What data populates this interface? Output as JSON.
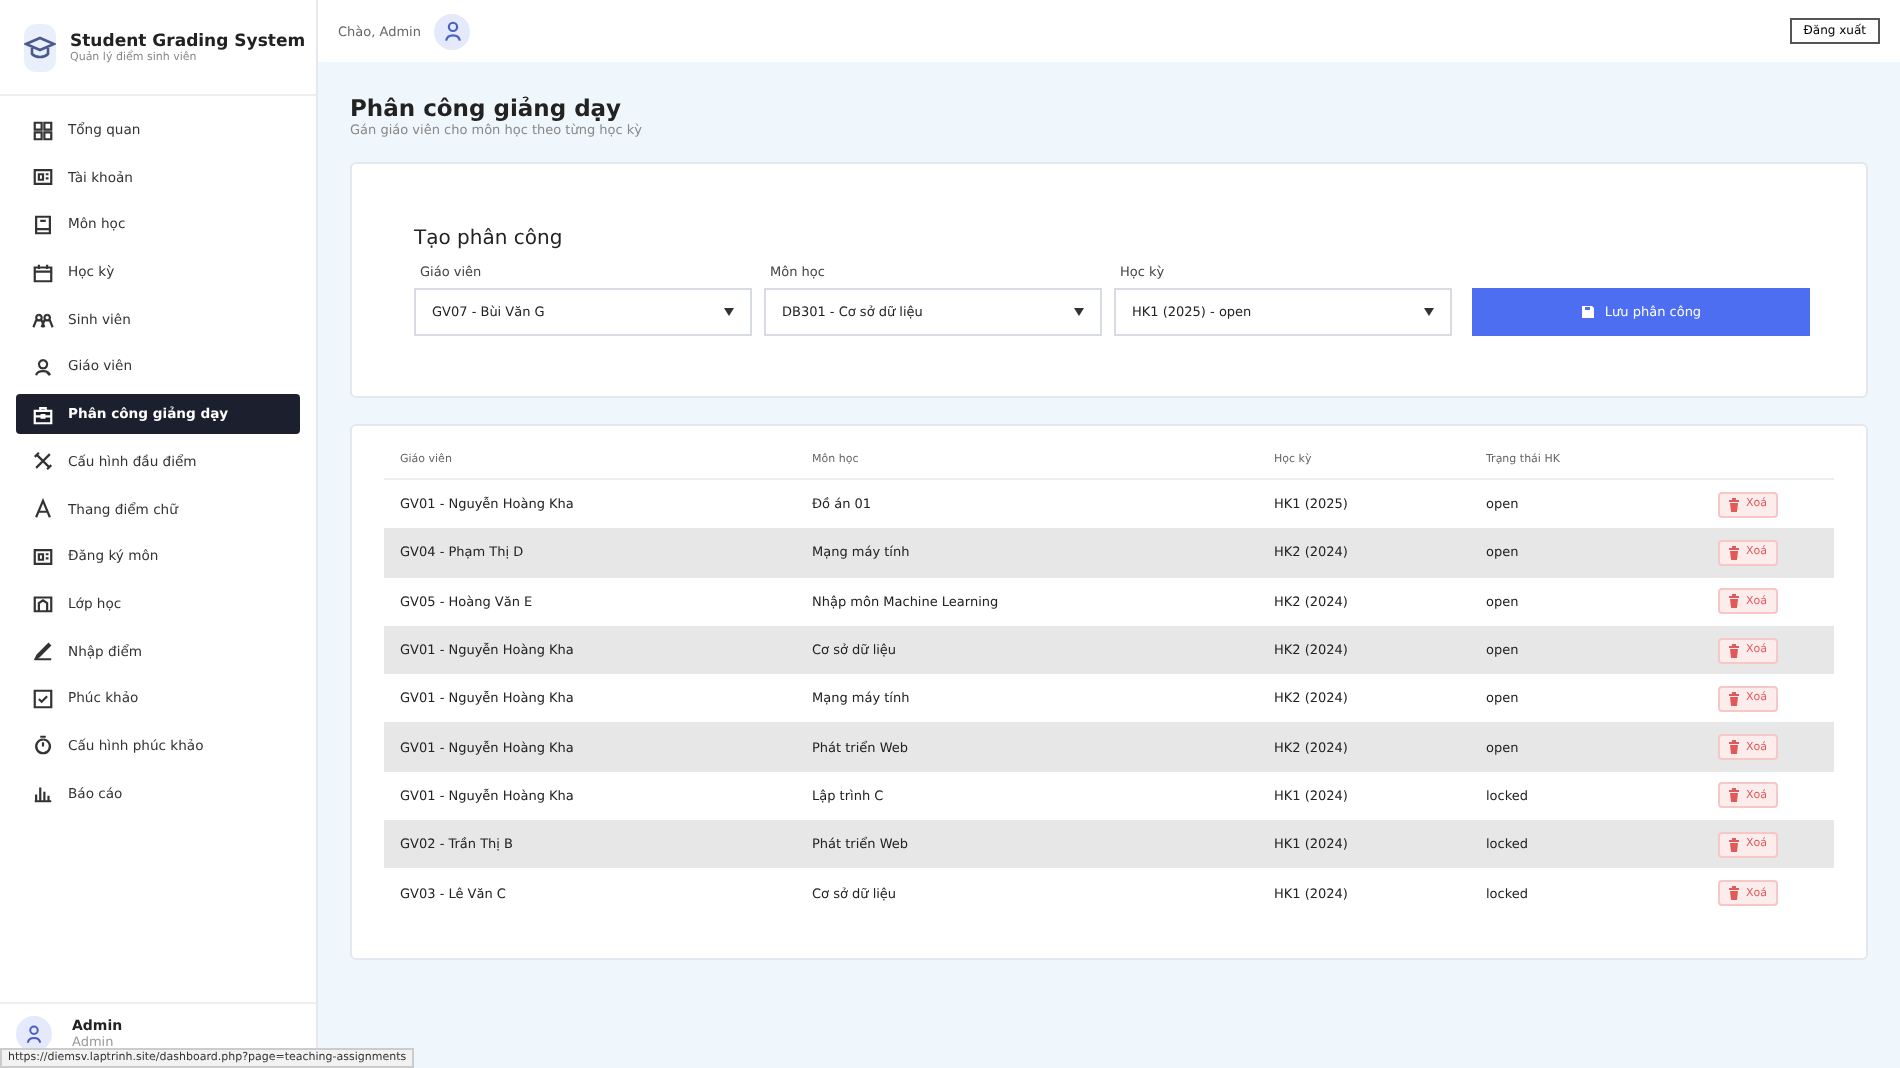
{
  "brand": {
    "title": "Student Grading System",
    "subtitle": "Quản lý điểm sinh viên"
  },
  "sidebar": {
    "items": [
      {
        "label": "Tổng quan",
        "selected": false
      },
      {
        "label": "Tài khoản",
        "selected": false
      },
      {
        "label": "Môn học",
        "selected": false
      },
      {
        "label": "Học kỳ",
        "selected": false
      },
      {
        "label": "Sinh viên",
        "selected": false
      },
      {
        "label": "Giáo viên",
        "selected": false
      },
      {
        "label": "Phân công giảng dạy",
        "selected": true
      },
      {
        "label": "Cấu hình đầu điểm",
        "selected": false
      },
      {
        "label": "Thang điểm chữ",
        "selected": false
      },
      {
        "label": "Đăng ký môn",
        "selected": false
      },
      {
        "label": "Lớp học",
        "selected": false
      },
      {
        "label": "Nhập điểm",
        "selected": false
      },
      {
        "label": "Phúc khảo",
        "selected": false
      },
      {
        "label": "Cấu hình phúc khảo",
        "selected": false
      },
      {
        "label": "Báo cáo",
        "selected": false
      }
    ],
    "user": {
      "name": "Admin",
      "role": "Admin"
    }
  },
  "header": {
    "greeting": "Chào, Admin",
    "logout": "Đăng xuất"
  },
  "page": {
    "title": "Phân công giảng dạy",
    "subtitle": "Gán giáo viên cho môn học theo từng học kỳ"
  },
  "form": {
    "title": "Tạo phân công",
    "fields": [
      {
        "label": "Giáo viên",
        "value": "GV07 - Bùi Văn G"
      },
      {
        "label": "Môn học",
        "value": "DB301 - Cơ sở dữ liệu"
      },
      {
        "label": "Học kỳ",
        "value": "HK1 (2025) - open"
      }
    ],
    "submit": "Lưu phân công"
  },
  "table": {
    "columns": [
      "Giáo viên",
      "Môn học",
      "Học kỳ",
      "Trạng thái HK"
    ],
    "rows": [
      {
        "cells": [
          "GV01 - Nguyễn Hoàng Kha",
          "Đồ án 01",
          "HK1 (2025)",
          "open"
        ],
        "action": "Xoá"
      },
      {
        "cells": [
          "GV04 - Phạm Thị D",
          "Mạng máy tính",
          "HK2 (2024)",
          "open"
        ],
        "action": "Xoá"
      },
      {
        "cells": [
          "GV05 - Hoàng Văn E",
          "Nhập môn Machine Learning",
          "HK2 (2024)",
          "open"
        ],
        "action": "Xoá"
      },
      {
        "cells": [
          "GV01 - Nguyễn Hoàng Kha",
          "Cơ sở dữ liệu",
          "HK2 (2024)",
          "open"
        ],
        "action": "Xoá"
      },
      {
        "cells": [
          "GV01 - Nguyễn Hoàng Kha",
          "Mạng máy tính",
          "HK2 (2024)",
          "open"
        ],
        "action": "Xoá"
      },
      {
        "cells": [
          "GV01 - Nguyễn Hoàng Kha",
          "Phát triển Web",
          "HK2 (2024)",
          "open"
        ],
        "action": "Xoá"
      },
      {
        "cells": [
          "GV01 - Nguyễn Hoàng Kha",
          "Lập trình C",
          "HK1 (2024)",
          "locked"
        ],
        "action": "Xoá"
      },
      {
        "cells": [
          "GV02 - Trần Thị B",
          "Phát triển Web",
          "HK1 (2024)",
          "locked"
        ],
        "action": "Xoá"
      },
      {
        "cells": [
          "GV03 - Lê Văn C",
          "Cơ sở dữ liệu",
          "HK1 (2024)",
          "locked"
        ],
        "action": "Xoá"
      }
    ]
  },
  "status_url": "https://diemsv.laptrinh.site/dashboard.php?page=teaching-assignments"
}
